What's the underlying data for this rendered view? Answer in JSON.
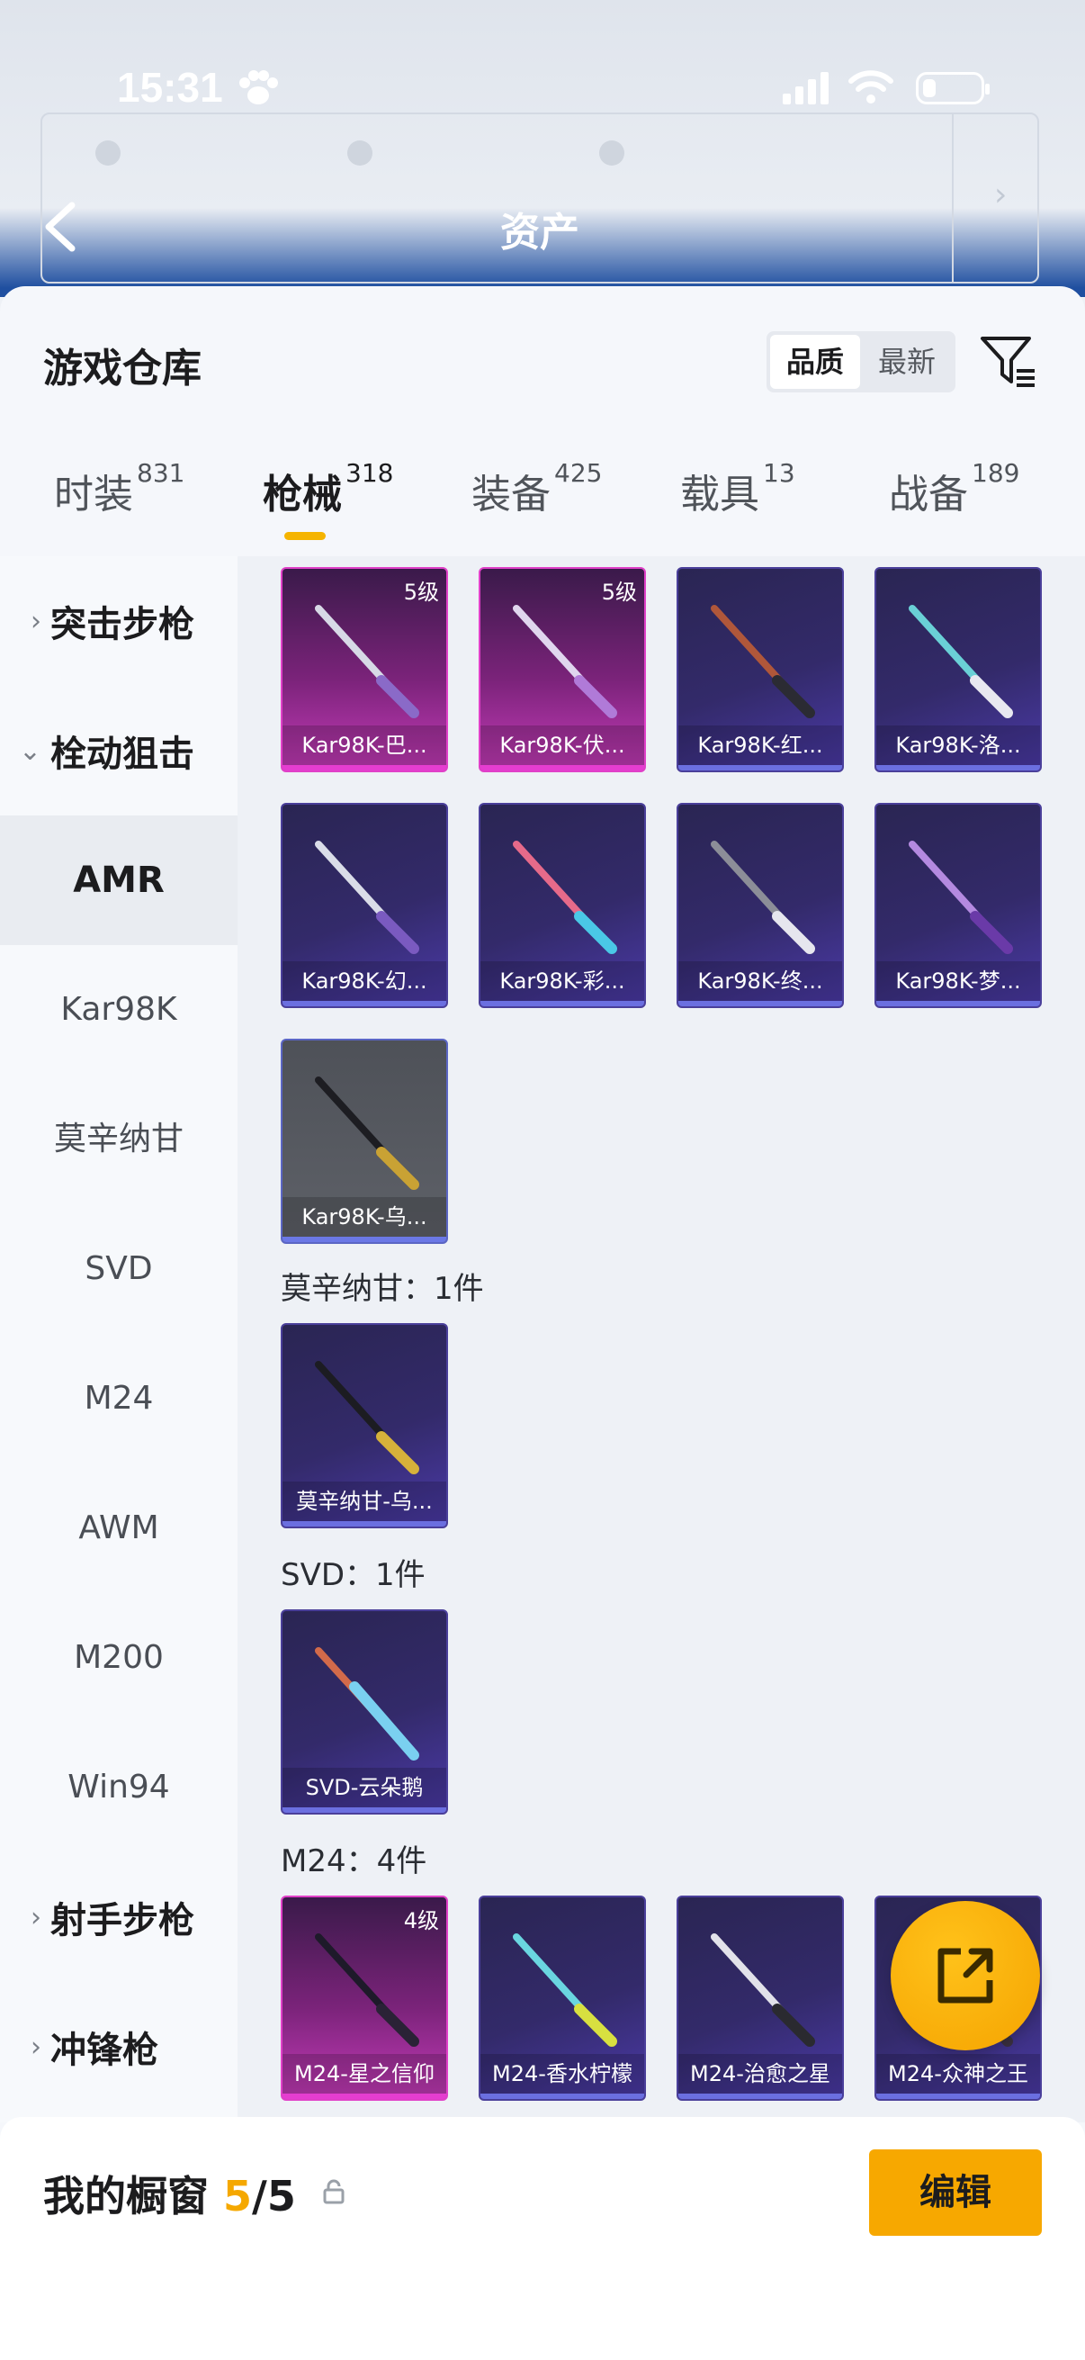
{
  "status_bar": {
    "time": "15:31"
  },
  "header": {
    "title": "资产"
  },
  "warehouse": {
    "title": "游戏仓库",
    "sort": {
      "active": "品质",
      "other": "最新"
    }
  },
  "tabs": [
    {
      "label": "时装",
      "count": "831"
    },
    {
      "label": "枪械",
      "count": "318"
    },
    {
      "label": "装备",
      "count": "425"
    },
    {
      "label": "载具",
      "count": "13"
    },
    {
      "label": "战备",
      "count": "189"
    }
  ],
  "sidebar": {
    "categories": {
      "assault": "突击步枪",
      "bolt": "栓动狙击",
      "marksman": "射手步枪",
      "smg": "冲锋枪"
    },
    "subs": [
      "AMR",
      "Kar98K",
      "莫辛纳甘",
      "SVD",
      "M24",
      "AWM",
      "M200",
      "Win94"
    ]
  },
  "cards_kar98k": [
    {
      "name": "Kar98K-巴...",
      "level": "5级"
    },
    {
      "name": "Kar98K-伏...",
      "level": "5级"
    },
    {
      "name": "Kar98K-红..."
    },
    {
      "name": "Kar98K-洛..."
    },
    {
      "name": "Kar98K-幻..."
    },
    {
      "name": "Kar98K-彩..."
    },
    {
      "name": "Kar98K-终..."
    },
    {
      "name": "Kar98K-梦..."
    },
    {
      "name": "Kar98K-乌..."
    }
  ],
  "sections": {
    "mosin": "莫辛纳甘：1件",
    "svd": "SVD：1件",
    "m24": "M24：4件"
  },
  "card_mosin": {
    "name": "莫辛纳甘-乌..."
  },
  "card_svd": {
    "name": "SVD-云朵鹅"
  },
  "cards_m24": [
    {
      "name": "M24-星之信仰",
      "level": "4级"
    },
    {
      "name": "M24-香水柠檬"
    },
    {
      "name": "M24-治愈之星"
    },
    {
      "name": "M24-众神之王"
    }
  ],
  "showcase": {
    "label": "我的橱窗",
    "current": "5",
    "total": "/5",
    "edit": "编辑"
  },
  "colors": {
    "accent": "#f7a800",
    "purple_card": "#332a6a",
    "pink_card": "#c43bb8"
  }
}
